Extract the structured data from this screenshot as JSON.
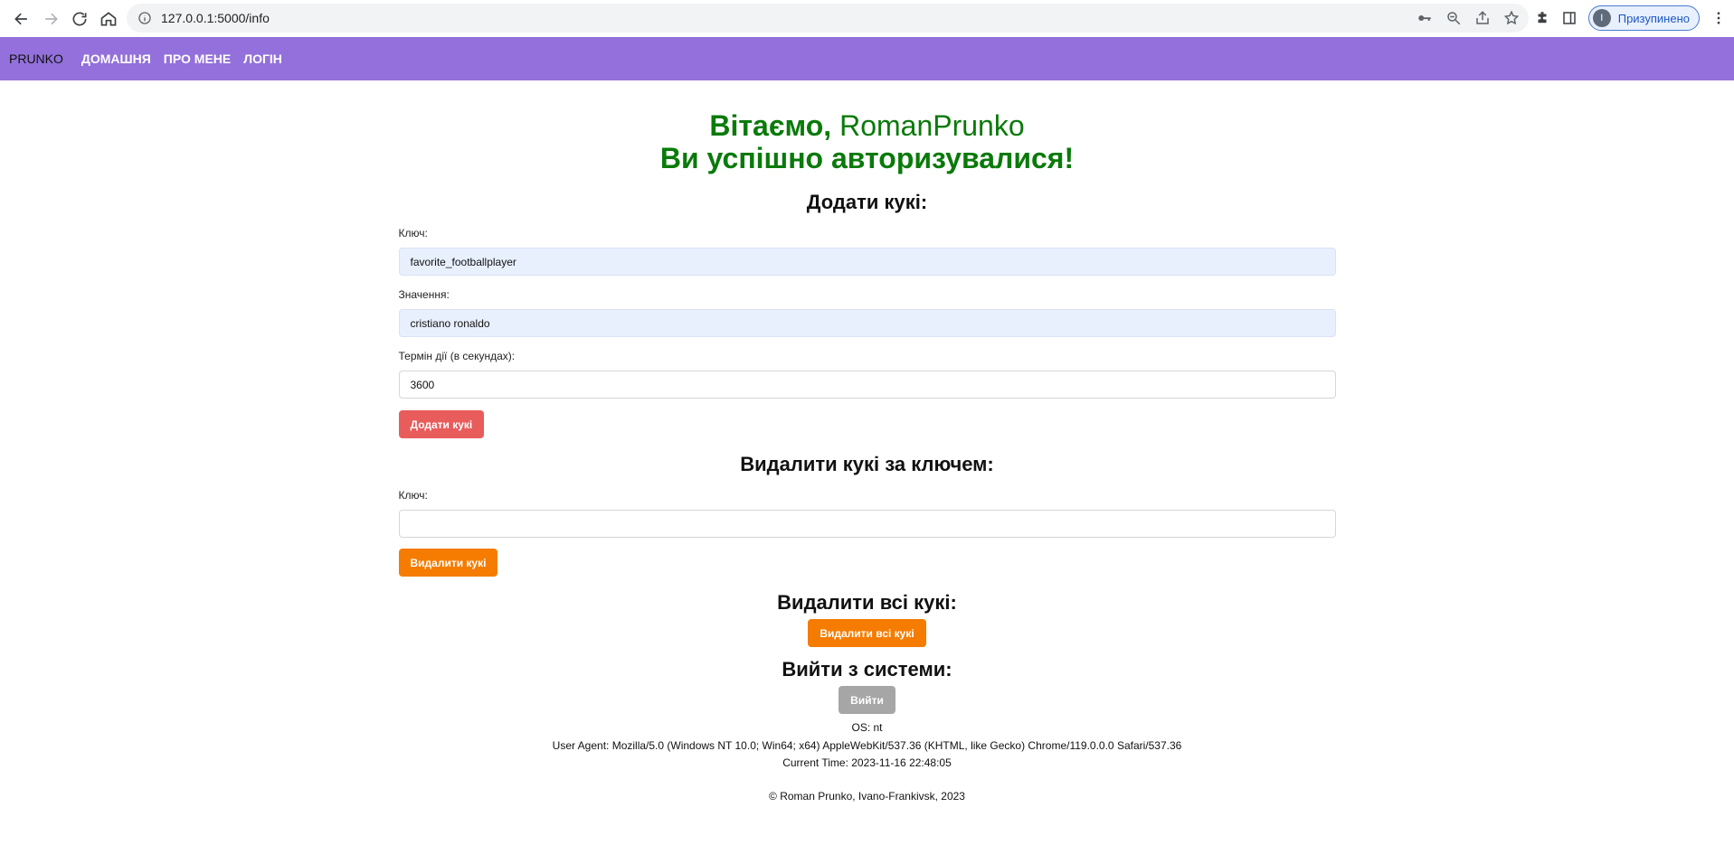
{
  "browser": {
    "url": "127.0.0.1:5000/info",
    "profile_label": "Призупинено",
    "profile_initial": "I"
  },
  "navbar": {
    "brand": "PRUNKO",
    "links": [
      "ДОМАШНЯ",
      "ПРО МЕНЕ",
      "ЛОГІН"
    ],
    "bg_color": "#9370db"
  },
  "welcome": {
    "greeting": "Вітаємо, ",
    "username": "RomanPrunko",
    "success": "Ви успішно авторизувалися!",
    "color": "#0a7a0a"
  },
  "add_cookie": {
    "title": "Додати кукі:",
    "key_label": "Ключ:",
    "key_value": "favorite_footballplayer",
    "value_label": "Значення:",
    "value_value": "cristiano ronaldo",
    "ttl_label": "Термін дії (в секундах):",
    "ttl_value": "3600",
    "button": "Додати кукі"
  },
  "delete_cookie": {
    "title": "Видалити кукі за ключем:",
    "key_label": "Ключ:",
    "key_value": "",
    "button": "Видалити кукі"
  },
  "delete_all": {
    "title": "Видалити всі кукі:",
    "button": "Видалити всі кукі"
  },
  "logout": {
    "title": "Вийти з системи:",
    "button": "Вийти"
  },
  "info": {
    "os": "OS: nt",
    "user_agent": "User Agent: Mozilla/5.0 (Windows NT 10.0; Win64; x64) AppleWebKit/537.36 (KHTML, like Gecko) Chrome/119.0.0.0 Safari/537.36",
    "current_time": "Current Time: 2023-11-16 22:48:05"
  },
  "footer": "© Roman Prunko, Ivano-Frankivsk, 2023"
}
